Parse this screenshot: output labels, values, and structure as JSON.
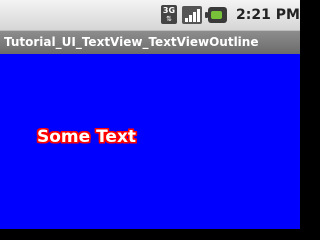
{
  "status_bar": {
    "network_type": "3G",
    "network_arrows": "⇅",
    "signal_icon": "signal-strength-icon",
    "battery_icon": "battery-icon",
    "time": "2:21 PM"
  },
  "title_bar": {
    "title": "Tutorial_UI_TextView_TextViewOutline"
  },
  "content": {
    "text": "Some Text",
    "background_color": "#0000ff",
    "text_color": "#ffffff",
    "outline_color": "#ff0000"
  }
}
